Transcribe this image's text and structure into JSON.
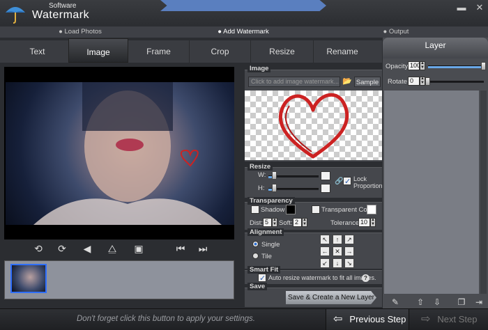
{
  "app": {
    "superscript": "Software",
    "title": "Watermark"
  },
  "window": {
    "minimize": "▬",
    "close": "✕"
  },
  "steps": [
    "Load Photos",
    "Add Watermark",
    "Output"
  ],
  "tabs": [
    "Text",
    "Image",
    "Frame",
    "Crop",
    "Resize",
    "Rename"
  ],
  "image_section": {
    "title": "Image",
    "placeholder": "Click to add image watermark...",
    "sample_label": "Sample"
  },
  "resize_section": {
    "title": "Resize",
    "w_label": "W:",
    "h_label": "H:",
    "lock_label_1": "Lock",
    "lock_label_2": "Proportion",
    "w_value": 0.12,
    "h_value": 0.12
  },
  "transparency_section": {
    "title": "Transparency",
    "shadow_label": "Shadow",
    "transparent_color_label": "Transparent Color",
    "dist_label": "Dist:",
    "dist_value": "5",
    "soft_label": "Soft:",
    "soft_value": "2",
    "tolerance_label": "Tolerance:",
    "tolerance_value": "10"
  },
  "alignment_section": {
    "title": "Alignment",
    "single_label": "Single",
    "tile_label": "Tile"
  },
  "smartfit_section": {
    "title": "Smart Fit",
    "auto_resize_label": "Auto resize watermark to fit all images.",
    "help": "?"
  },
  "save_section": {
    "title": "Save",
    "save_button": "Save & Create a New Layer"
  },
  "layer_panel": {
    "title": "Layer",
    "opacity_label": "Opacity",
    "opacity_value": "100",
    "opacity_level": 1.0,
    "rotate_label": "Rotate",
    "rotate_value": "0",
    "rotate_level": 0.0
  },
  "bottom": {
    "hint": "Don't forget click this button to apply your settings.",
    "prev_label": "Previous Step",
    "next_label": "Next Step"
  },
  "colors": {
    "accent": "#5a7fbf",
    "heart": "#cc2222"
  }
}
